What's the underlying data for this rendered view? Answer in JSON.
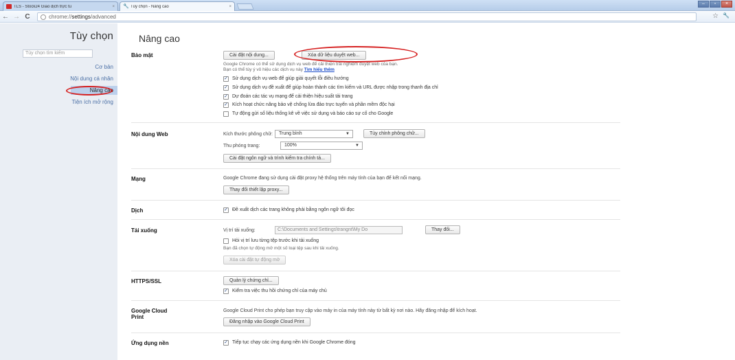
{
  "browser": {
    "tabs": [
      {
        "label": "TLS - Stock24 Giao dịch trực tu",
        "close": "×"
      },
      {
        "label": "Tùy chọn - Nâng cao",
        "close": "×"
      }
    ],
    "address": {
      "scheme": "chrome://",
      "host": "settings",
      "path": "/advanced"
    },
    "nav": {
      "back": "←",
      "forward": "→",
      "reload": "C"
    },
    "toolbar_icons": {
      "star": "☆",
      "wrench": "🔧"
    },
    "window_controls": {
      "minimize": "–",
      "maximize": "▫",
      "close": "×"
    }
  },
  "sidebar": {
    "title": "Tùy chọn",
    "search_placeholder": "Tùy chọn tìm kiếm",
    "items": [
      {
        "label": "Cơ bản"
      },
      {
        "label": "Nội dung cá nhân"
      },
      {
        "label": "Nâng cao"
      },
      {
        "label": "Tiện ích mở rộng"
      }
    ]
  },
  "page": {
    "title": "Nâng cao",
    "privacy": {
      "label": "Bảo mật",
      "btn_content": "Cài đặt nội dung...",
      "btn_clear": "Xóa dữ liệu duyệt web...",
      "desc1": "Google Chrome có thể sử dụng dịch vụ web để cải thiện trải nghiệm duyệt web của bạn.",
      "desc2": "Bạn có thể tùy ý vô hiệu các dịch vụ này",
      "learn_more": "Tìm hiểu thêm",
      "checks": [
        {
          "label": "Sử dụng dịch vụ web để giúp giải quyết lỗi điều hướng",
          "mark": "✓"
        },
        {
          "label": "Sử dụng dịch vụ đề xuất để giúp hoàn thành các tìm kiếm và URL được nhập trong thanh địa chỉ",
          "mark": "✓"
        },
        {
          "label": "Dự đoán các tác vụ mạng để cải thiện hiệu suất tải trang",
          "mark": "✓"
        },
        {
          "label": "Kích hoạt chức năng bảo vệ chống lừa đảo trực tuyến và phần mềm độc hại",
          "mark": "✓"
        },
        {
          "label": "Tự động gửi số liệu thống kê về việc sử dụng và báo cáo sự cố cho Google",
          "mark": ""
        }
      ]
    },
    "web_content": {
      "label": "Nội dung Web",
      "font_size_label": "Kích thước phông chữ:",
      "font_size_value": "Trung bình",
      "btn_fonts": "Tùy chỉnh phông chữ...",
      "zoom_label": "Thu phóng trang:",
      "zoom_value": "100%",
      "btn_lang": "Cài đặt ngôn ngữ và trình kiểm tra chính tả..."
    },
    "network": {
      "label": "Mạng",
      "desc": "Google Chrome đang sử dụng cài đặt proxy hệ thống trên máy tính của bạn để kết nối mạng.",
      "btn_proxy": "Thay đổi thiết lập proxy..."
    },
    "translate": {
      "label": "Dịch",
      "check": "Đề xuất dịch các trang không phải bằng ngôn ngữ tôi đọc",
      "mark": "✓"
    },
    "downloads": {
      "label": "Tải xuống",
      "location_label": "Vị trí tải xuống:",
      "location_value": "C:\\Documents and Settings\\trangnt\\My Do",
      "btn_change": "Thay đổi...",
      "ask_check": "Hỏi vị trí lưu từng tệp trước khi tải xuống",
      "ask_mark": "",
      "auto_open_note": "Bạn đã chọn tự động mở một số loại tệp sau khi tải xuống.",
      "btn_clear_auto": "Xóa cài đặt tự động mở"
    },
    "https": {
      "label": "HTTPS/SSL",
      "btn_certs": "Quản lý chứng chỉ...",
      "check": "Kiểm tra việc thu hồi chứng chỉ của máy chủ",
      "mark": "✓"
    },
    "cloud_print": {
      "label": "Google Cloud Print",
      "desc": "Google Cloud Print cho phép bạn truy cập vào máy in của máy tính này từ bất kỳ nơi nào. Hãy đăng nhập để kích hoạt.",
      "btn_signin": "Đăng nhập vào Google Cloud Print"
    },
    "background": {
      "label": "Ứng dụng nền",
      "check": "Tiếp tục chạy các ứng dụng nền khi Google Chrome đóng",
      "mark": "✓"
    }
  },
  "annotation_colors": {
    "oval": "#d62020"
  }
}
